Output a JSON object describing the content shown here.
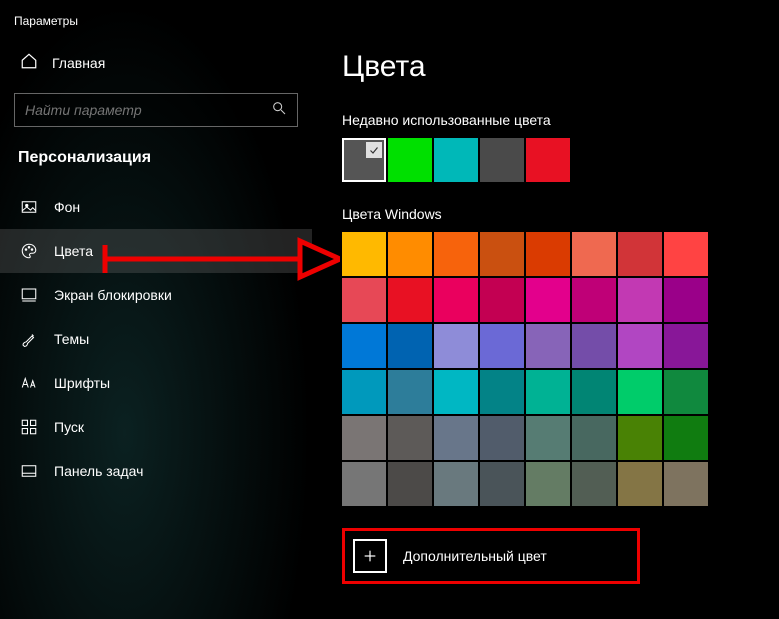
{
  "window_title": "Параметры",
  "home_label": "Главная",
  "search": {
    "placeholder": "Найти параметр"
  },
  "section_title": "Персонализация",
  "nav": [
    {
      "key": "background",
      "label": "Фон",
      "icon": "image"
    },
    {
      "key": "colors",
      "label": "Цвета",
      "icon": "palette",
      "active": true
    },
    {
      "key": "lockscreen",
      "label": "Экран блокировки",
      "icon": "lockscreen"
    },
    {
      "key": "themes",
      "label": "Темы",
      "icon": "brush"
    },
    {
      "key": "fonts",
      "label": "Шрифты",
      "icon": "fonts"
    },
    {
      "key": "start",
      "label": "Пуск",
      "icon": "grid"
    },
    {
      "key": "taskbar",
      "label": "Панель задач",
      "icon": "taskbar"
    }
  ],
  "page_title": "Цвета",
  "recent_title": "Недавно использованные цвета",
  "recent_colors": [
    {
      "hex": "#555555",
      "selected": true
    },
    {
      "hex": "#00e000"
    },
    {
      "hex": "#00b8b8"
    },
    {
      "hex": "#4a4a4a"
    },
    {
      "hex": "#e81123"
    }
  ],
  "grid_title": "Цвета Windows",
  "grid_colors": [
    "#ffb900",
    "#ff8c00",
    "#f7630c",
    "#ca5010",
    "#da3b01",
    "#ef6950",
    "#d13438",
    "#ff4343",
    "#e74856",
    "#e81123",
    "#ea005e",
    "#c30052",
    "#e3008c",
    "#bf0077",
    "#c239b3",
    "#9a0089",
    "#0078d7",
    "#0063b1",
    "#8e8cd8",
    "#6b69d6",
    "#8764b8",
    "#744da9",
    "#b146c2",
    "#881798",
    "#0099bc",
    "#2d7d9a",
    "#00b7c3",
    "#038387",
    "#00b294",
    "#018574",
    "#00cc6a",
    "#10893e",
    "#7a7574",
    "#5d5a58",
    "#68768a",
    "#515c6b",
    "#567c73",
    "#486860",
    "#498205",
    "#107c10",
    "#767676",
    "#4c4a48",
    "#69797e",
    "#4a5459",
    "#647c64",
    "#525e54",
    "#847545",
    "#7e735f"
  ],
  "custom_color_label": "Дополнительный цвет"
}
